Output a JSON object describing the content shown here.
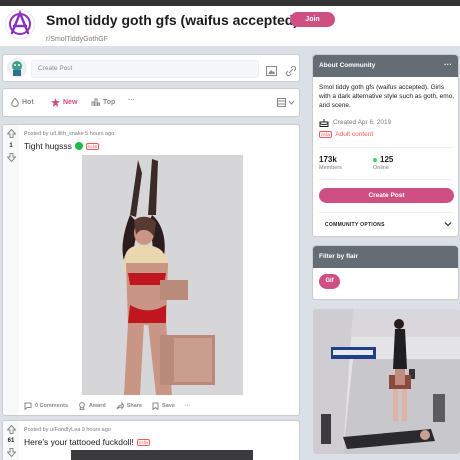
{
  "header": {
    "title": "Smol tiddy goth gfs (waifus accepted)",
    "subreddit": "r/SmolTiddyGothGF",
    "join_label": "Join",
    "icon": "anarchy-icon"
  },
  "create_post": {
    "placeholder": "Create Post"
  },
  "sort": {
    "hot": "Hot",
    "new": "New",
    "top": "Top",
    "more": "···"
  },
  "posts": [
    {
      "meta": "Posted by u/Lilith_snake 5 hours ago",
      "title": "Tight hugsss",
      "nsfw": "nsfw",
      "votes": "1",
      "actions": {
        "comments": "0 Comments",
        "award": "Award",
        "share": "Share",
        "save": "Save",
        "more": "···"
      }
    },
    {
      "meta": "Posted by u/FondlyLea 9 hours ago",
      "title": "Here's your tattooed fuckdoll!",
      "nsfw": "nsfw",
      "votes": "61"
    }
  ],
  "about": {
    "header": "About Community",
    "description": "Smol tiddy goth gfs (waifus accepted). Girls with a dark alternative style such as goth, emo, and scene.",
    "created": "Created Apr 6, 2019",
    "adult": "Adult content",
    "adult_tag": "nsfw",
    "members_value": "173k",
    "members_label": "Members",
    "online_value": "125",
    "online_label": "Online",
    "create_post_label": "Create Post",
    "community_options": "COMMUNITY OPTIONS"
  },
  "flair": {
    "header": "Filter by flair",
    "button": "Gif"
  },
  "colors": {
    "accent": "#cf4f83",
    "nsfw": "#ff585b",
    "online": "#46d160",
    "card_header": "#646d73"
  }
}
